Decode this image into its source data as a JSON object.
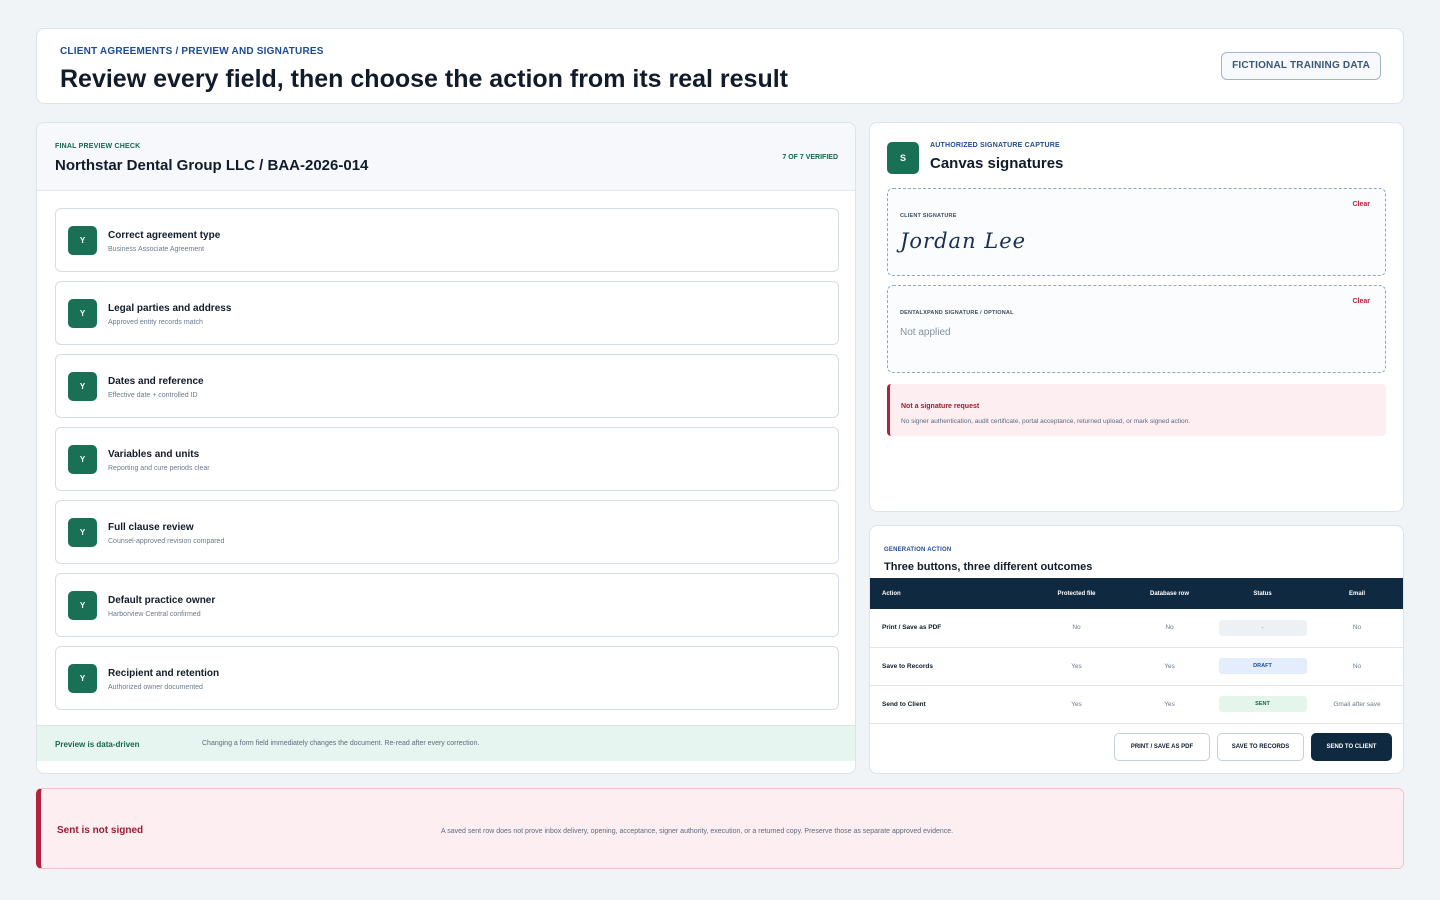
{
  "header": {
    "eyebrow": "CLIENT AGREEMENTS / PREVIEW AND SIGNATURES",
    "title": "Review every field, then choose the action from its real result",
    "badge": "FICTIONAL TRAINING DATA"
  },
  "preview": {
    "eyebrow": "FINAL PREVIEW CHECK",
    "title": "Northstar Dental Group LLC / BAA-2026-014",
    "verified": "7 OF 7 VERIFIED",
    "check_mark": "Y",
    "items": [
      {
        "title": "Correct agreement type",
        "sub": "Business Associate Agreement"
      },
      {
        "title": "Legal parties and address",
        "sub": "Approved entity records match"
      },
      {
        "title": "Dates and reference",
        "sub": "Effective date + controlled ID"
      },
      {
        "title": "Variables and units",
        "sub": "Reporting and cure periods clear"
      },
      {
        "title": "Full clause review",
        "sub": "Counsel-approved revision compared"
      },
      {
        "title": "Default practice owner",
        "sub": "Harborview Central confirmed"
      },
      {
        "title": "Recipient and retention",
        "sub": "Authorized owner documented"
      }
    ],
    "footer_label": "Preview is data-driven",
    "footer_text": "Changing a form field immediately changes the document. Re-read after every correction."
  },
  "signatures": {
    "icon_letter": "S",
    "eyebrow": "AUTHORIZED SIGNATURE CAPTURE",
    "title": "Canvas signatures",
    "client_label": "CLIENT SIGNATURE",
    "client_signature": "Jordan Lee",
    "dental_label": "DENTALXPAND SIGNATURE / OPTIONAL",
    "dental_value": "Not applied",
    "clear_label": "Clear",
    "notice_title": "Not a signature request",
    "notice_text": "No signer authentication, audit certificate, portal acceptance, returned upload, or mark signed action."
  },
  "generation": {
    "eyebrow": "GENERATION ACTION",
    "title": "Three buttons, three different outcomes",
    "columns": [
      "Action",
      "Protected file",
      "Database row",
      "Status",
      "Email"
    ],
    "rows": [
      {
        "action": "Print / Save as PDF",
        "file": "No",
        "db": "No",
        "status": "-",
        "email": "No"
      },
      {
        "action": "Save to Records",
        "file": "Yes",
        "db": "Yes",
        "status": "DRAFT",
        "email": "No"
      },
      {
        "action": "Send to Client",
        "file": "Yes",
        "db": "Yes",
        "status": "SENT",
        "email": "Gmail after save"
      }
    ],
    "buttons": {
      "print": "PRINT / SAVE AS PDF",
      "records": "SAVE TO RECORDS",
      "send": "SEND TO CLIENT"
    }
  },
  "alert": {
    "title": "Sent is not signed",
    "text": "A saved sent row does not prove inbox delivery, opening, acceptance, signer authority, execution, or a returned copy. Preserve those as separate approved evidence."
  },
  "colors": {
    "accent_green": "#1a7055",
    "navy": "#0f2940",
    "danger": "#b3213a",
    "link_blue": "#1e4b8f"
  }
}
